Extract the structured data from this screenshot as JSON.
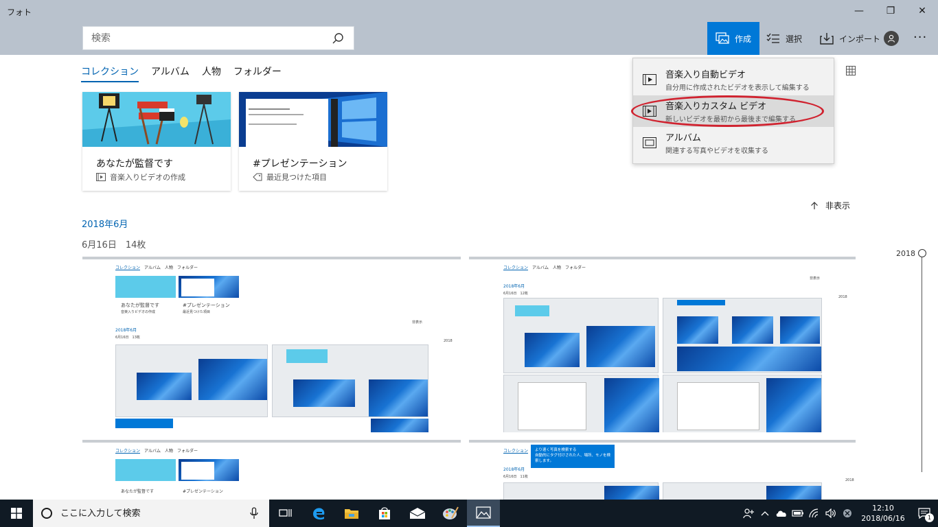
{
  "window": {
    "title": "フォト",
    "minimize": "—",
    "maximize": "❐",
    "close": "✕"
  },
  "search": {
    "placeholder": "検索"
  },
  "toolbar": {
    "create_label": "作成",
    "select_label": "選択",
    "import_label": "インポート",
    "more_label": "···"
  },
  "tabs": [
    {
      "label": "コレクション",
      "active": true
    },
    {
      "label": "アルバム",
      "active": false
    },
    {
      "label": "人物",
      "active": false
    },
    {
      "label": "フォルダー",
      "active": false
    }
  ],
  "cards": [
    {
      "title": "あなたが監督です",
      "subtitle": "音楽入りビデオの作成"
    },
    {
      "title": "#プレゼンテーション",
      "subtitle": "最近見つけた項目"
    }
  ],
  "create_menu": {
    "items": [
      {
        "title": "音楽入り自動ビデオ",
        "desc": "自分用に作成されたビデオを表示して編集する"
      },
      {
        "title": "音楽入りカスタム ビデオ",
        "desc": "新しいビデオを最初から最後まで編集する"
      },
      {
        "title": "アルバム",
        "desc": "関連する写真やビデオを収集する"
      }
    ],
    "highlighted_index": 1
  },
  "hide_toggle": {
    "label": "非表示"
  },
  "collection": {
    "month": "2018年6月",
    "day": "6月16日　14枚"
  },
  "timeline": {
    "year": "2018"
  },
  "thumbnails": {
    "mini_tabs": [
      "コレクション",
      "アルバム",
      "人物",
      "フォルダー"
    ],
    "mini_card1": "あなたが監督です",
    "mini_card1_sub": "音楽入りビデオの作成",
    "mini_card2": "#プレゼンテーション",
    "mini_card2_sub": "最近見つけた項目",
    "mini_month": "2018年6月",
    "mini_day": "6月16日　13枚",
    "mini_day2": "6月16日　12枚",
    "mini_day3": "6月16日　11枚",
    "mini_hide": "非表示",
    "mini_year": "2018",
    "tooltip_title": "より速く写真を検索する",
    "tooltip_body": "自動的にタグ付けされた人、場所、モノを検索します。"
  },
  "taskbar": {
    "search_placeholder": "ここに入力して検索",
    "time": "12:10",
    "date": "2018/06/16",
    "notification_count": "1"
  },
  "colors": {
    "accent": "#0078d7",
    "header_bg": "#b9c2cd",
    "highlight_ring": "#d0222f",
    "taskbar_bg": "#101a24"
  }
}
